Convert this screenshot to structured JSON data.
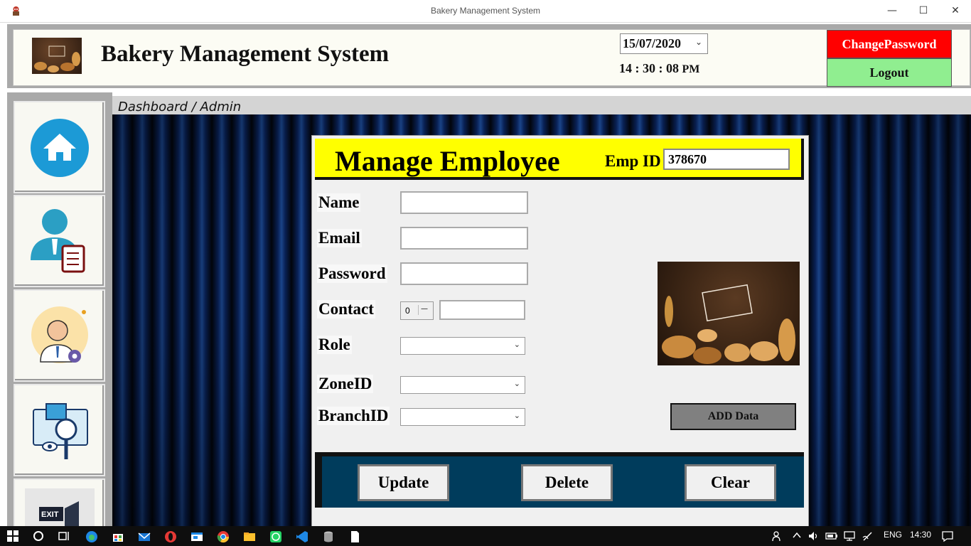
{
  "window": {
    "title": "Bakery Management System",
    "minimize": "—",
    "maximize": "☐",
    "close": "✕"
  },
  "header": {
    "app_name": "Bakery Management System",
    "date": "15/07/2020",
    "time": "14 : 30 : 08",
    "ampm": "PM",
    "change_password": "ChangePassword",
    "logout": "Logout"
  },
  "breadcrumb": "Dashboard / Admin",
  "sidebar": {
    "items": [
      {
        "icon": "home-icon"
      },
      {
        "icon": "employee-icon"
      },
      {
        "icon": "user-settings-icon"
      },
      {
        "icon": "inspect-icon"
      },
      {
        "icon": "exit-icon",
        "label": "EXIT"
      }
    ]
  },
  "form": {
    "title": "Manage Employee",
    "emp_id_label": "Emp ID",
    "emp_id": "378670",
    "labels": {
      "name": "Name",
      "email": "Email",
      "password": "Password",
      "contact": "Contact",
      "role": "Role",
      "zone": "ZoneID",
      "branch": "BranchID"
    },
    "values": {
      "name": "",
      "email": "",
      "password": "",
      "contact_code": "0",
      "contact": "",
      "role": "",
      "zone": "",
      "branch": ""
    },
    "add_button": "ADD Data",
    "update_button": "Update",
    "delete_button": "Delete",
    "clear_button": "Clear"
  },
  "taskbar": {
    "language": "ENG",
    "clock": "14:30"
  },
  "colors": {
    "header_yellow": "#ffff00",
    "change_password_red": "#ff0000",
    "logout_green": "#90ee90",
    "action_bar": "#003c5c"
  }
}
